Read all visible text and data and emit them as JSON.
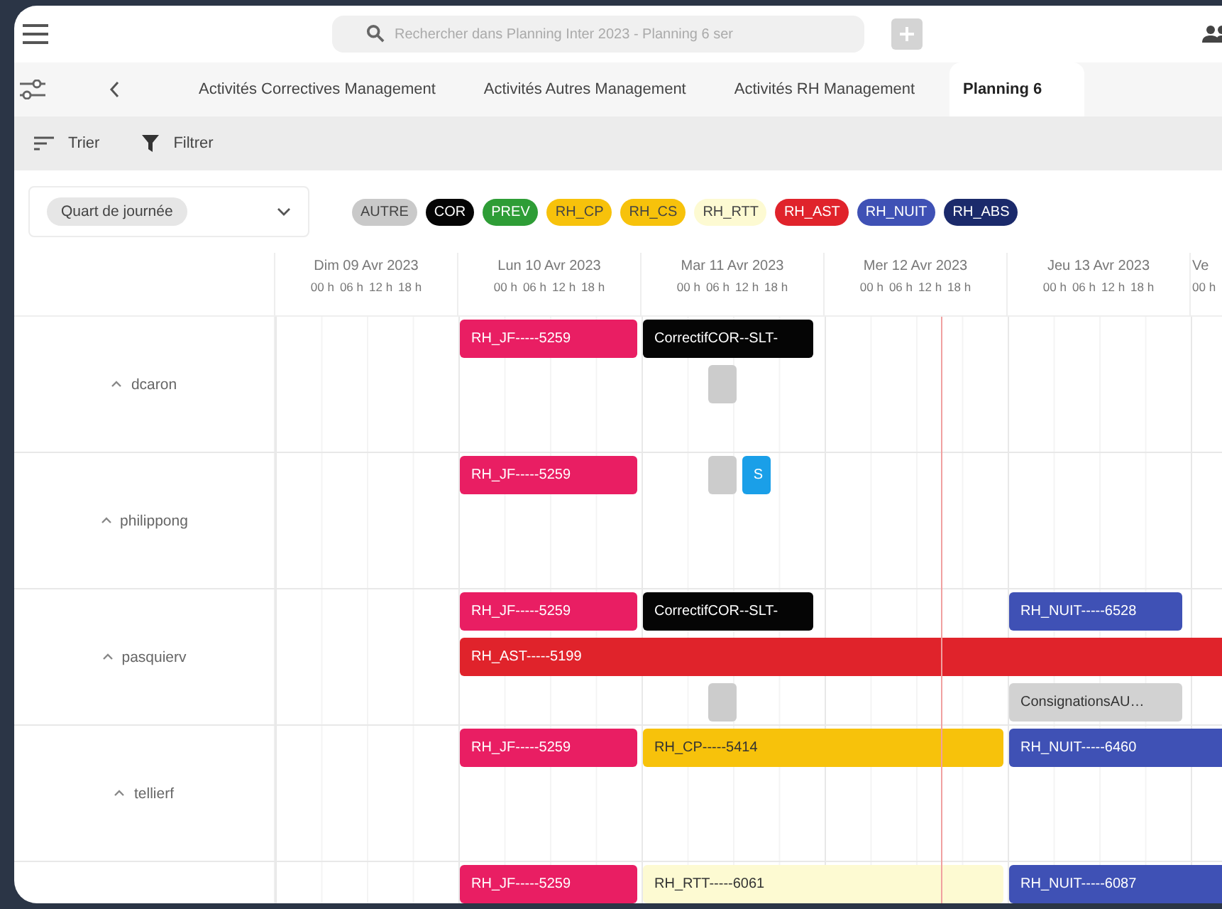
{
  "top_bar": {
    "search": {
      "placeholder": "Rechercher dans Planning Inter 2023 - Planning 6 ser"
    }
  },
  "tabs": [
    {
      "label": "Activités Correctives Management",
      "selected": false
    },
    {
      "label": "Activités Autres Management",
      "selected": false
    },
    {
      "label": "Activités RH Management",
      "selected": false
    },
    {
      "label": "Planning 6",
      "selected": true
    }
  ],
  "toolbar": {
    "sort": "Trier",
    "filter": "Filtrer"
  },
  "period_select": {
    "value": "Quart de journée"
  },
  "legend": [
    {
      "label": "AUTRE",
      "color": "#c9c9c9"
    },
    {
      "label": "COR",
      "color": "#050505"
    },
    {
      "label": "PREV",
      "color": "#2e9d36"
    },
    {
      "label": "RH_CP",
      "color": "#f7c20b"
    },
    {
      "label": "RH_CS",
      "color": "#f7c20b"
    },
    {
      "label": "RH_RTT",
      "color": "#fdfad2"
    },
    {
      "label": "RH_AST",
      "color": "#e0232b"
    },
    {
      "label": "RH_NUIT",
      "color": "#3f51b5"
    },
    {
      "label": "RH_ABS",
      "color": "#1b2a6b"
    }
  ],
  "timeline": {
    "days": [
      {
        "label": "Dim 09 Avr 2023",
        "hours": [
          "00 h",
          "06 h",
          "12 h",
          "18 h"
        ]
      },
      {
        "label": "Lun 10 Avr 2023",
        "hours": [
          "00 h",
          "06 h",
          "12 h",
          "18 h"
        ]
      },
      {
        "label": "Mar 11 Avr 2023",
        "hours": [
          "00 h",
          "06 h",
          "12 h",
          "18 h"
        ]
      },
      {
        "label": "Mer 12 Avr 2023",
        "hours": [
          "00 h",
          "06 h",
          "12 h",
          "18 h"
        ]
      },
      {
        "label": "Jeu 13 Avr 2023",
        "hours": [
          "00 h",
          "06 h",
          "12 h",
          "18 h"
        ]
      },
      {
        "label": "Ve",
        "hours": [
          "00 h"
        ]
      }
    ]
  },
  "rows": [
    {
      "name": "dcaron",
      "expanded": true,
      "events": [
        {
          "label": "RH_JF-----5259",
          "color": "#e91e63"
        },
        {
          "label": "CorrectifCOR--SLT-",
          "color": "#050505"
        },
        {
          "color": "#cccccc"
        }
      ]
    },
    {
      "name": "philippong",
      "expanded": true,
      "events": [
        {
          "label": "RH_JF-----5259",
          "color": "#e91e63"
        },
        {
          "color": "#cccccc"
        },
        {
          "label": "S",
          "color": "#1a9fe8"
        }
      ]
    },
    {
      "name": "pasquierv",
      "expanded": true,
      "events": [
        {
          "label": "RH_JF-----5259",
          "color": "#e91e63"
        },
        {
          "label": "CorrectifCOR--SLT-",
          "color": "#050505"
        },
        {
          "label": "RH_NUIT-----6528",
          "color": "#3f51b5"
        },
        {
          "label": "RH_AST-----5199",
          "color": "#e0232b"
        },
        {
          "color": "#cccccc"
        },
        {
          "label": "ConsignationsAU…",
          "color": "#d2d2d2"
        }
      ]
    },
    {
      "name": "tellierf",
      "expanded": true,
      "events": [
        {
          "label": "RH_JF-----5259",
          "color": "#e91e63"
        },
        {
          "label": "RH_CP-----5414",
          "color": "#f7c20b"
        },
        {
          "label": "RH_NUIT-----6460",
          "color": "#3f51b5"
        }
      ]
    },
    {
      "events": [
        {
          "label": "RH_JF-----5259",
          "color": "#e91e63"
        },
        {
          "label": "RH_RTT-----6061",
          "color": "#fdfad2"
        },
        {
          "label": "RH_NUIT-----6087",
          "color": "#3f51b5"
        }
      ]
    }
  ]
}
